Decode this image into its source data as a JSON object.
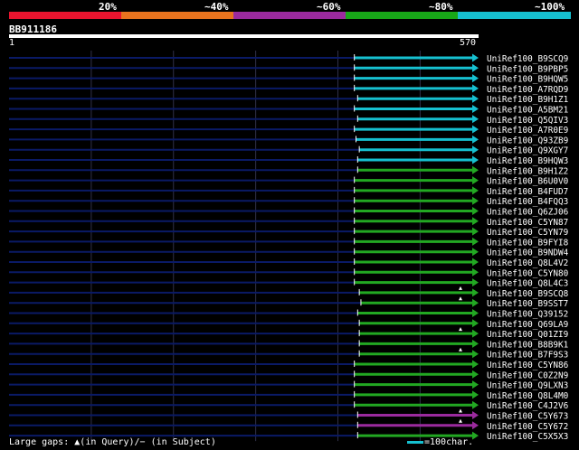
{
  "scale": {
    "labels": [
      "20%",
      "~40%",
      "~60%",
      "~80%",
      "~100%"
    ],
    "colors": [
      "#e8142e",
      "#e8731e",
      "#9b2a9e",
      "#18a818",
      "#16c0d0"
    ]
  },
  "query": {
    "id": "BB911186",
    "start": "1",
    "end": "570",
    "length": 570
  },
  "colors": {
    "cyan": "#16c0d0",
    "green": "#22a822",
    "purple": "#9b2a9e",
    "navy": "#0a1a66",
    "grid": "#30304a"
  },
  "hits": [
    {
      "name": "UniRef100_B9SCQ9",
      "start": 420,
      "color": "cyan",
      "gap": false
    },
    {
      "name": "UniRef100_B9PBP5",
      "start": 420,
      "color": "cyan",
      "gap": false
    },
    {
      "name": "UniRef100_B9HQW5",
      "start": 420,
      "color": "cyan",
      "gap": false
    },
    {
      "name": "UniRef100_A7RQD9",
      "start": 420,
      "color": "cyan",
      "gap": false
    },
    {
      "name": "UniRef100_B9H1Z1",
      "start": 424,
      "color": "cyan",
      "gap": false
    },
    {
      "name": "UniRef100_A5BM21",
      "start": 420,
      "color": "cyan",
      "gap": false
    },
    {
      "name": "UniRef100_Q5QIV3",
      "start": 424,
      "color": "cyan",
      "gap": false
    },
    {
      "name": "UniRef100_A7R0E9",
      "start": 420,
      "color": "cyan",
      "gap": false
    },
    {
      "name": "UniRef100_Q93ZB9",
      "start": 422,
      "color": "cyan",
      "gap": false
    },
    {
      "name": "UniRef100_Q9XGY7",
      "start": 426,
      "color": "cyan",
      "gap": false
    },
    {
      "name": "UniRef100_B9HQW3",
      "start": 424,
      "color": "cyan",
      "gap": false
    },
    {
      "name": "UniRef100_B9H1Z2",
      "start": 424,
      "color": "green",
      "gap": false
    },
    {
      "name": "UniRef100_B6U0V0",
      "start": 420,
      "color": "green",
      "gap": false
    },
    {
      "name": "UniRef100_B4FUD7",
      "start": 420,
      "color": "green",
      "gap": false
    },
    {
      "name": "UniRef100_B4FQQ3",
      "start": 420,
      "color": "green",
      "gap": false
    },
    {
      "name": "UniRef100_Q6ZJ06",
      "start": 420,
      "color": "green",
      "gap": false
    },
    {
      "name": "UniRef100_C5YN87",
      "start": 420,
      "color": "green",
      "gap": false
    },
    {
      "name": "UniRef100_C5YN79",
      "start": 420,
      "color": "green",
      "gap": false
    },
    {
      "name": "UniRef100_B9FYI8",
      "start": 420,
      "color": "green",
      "gap": false
    },
    {
      "name": "UniRef100_B9NDW4",
      "start": 420,
      "color": "green",
      "gap": false
    },
    {
      "name": "UniRef100_Q8L4V2",
      "start": 420,
      "color": "green",
      "gap": false
    },
    {
      "name": "UniRef100_C5YN80",
      "start": 420,
      "color": "green",
      "gap": false
    },
    {
      "name": "UniRef100_Q8L4C3",
      "start": 420,
      "color": "green",
      "gap": false
    },
    {
      "name": "UniRef100_B9SCQ8",
      "start": 426,
      "color": "green",
      "gap": true
    },
    {
      "name": "UniRef100_B9SST7",
      "start": 428,
      "color": "green",
      "gap": true
    },
    {
      "name": "UniRef100_Q39152",
      "start": 424,
      "color": "green",
      "gap": false
    },
    {
      "name": "UniRef100_Q69LA9",
      "start": 426,
      "color": "green",
      "gap": false
    },
    {
      "name": "UniRef100_Q01ZI9",
      "start": 426,
      "color": "green",
      "gap": true
    },
    {
      "name": "UniRef100_B8B9K1",
      "start": 426,
      "color": "green",
      "gap": false
    },
    {
      "name": "UniRef100_B7F9S3",
      "start": 426,
      "color": "green",
      "gap": true
    },
    {
      "name": "UniRef100_C5YN86",
      "start": 420,
      "color": "green",
      "gap": false
    },
    {
      "name": "UniRef100_C0Z2N9",
      "start": 420,
      "color": "green",
      "gap": false
    },
    {
      "name": "UniRef100_Q9LXN3",
      "start": 420,
      "color": "green",
      "gap": false
    },
    {
      "name": "UniRef100_Q8L4M0",
      "start": 420,
      "color": "green",
      "gap": false
    },
    {
      "name": "UniRef100_C4J2V6",
      "start": 420,
      "color": "green",
      "gap": false
    },
    {
      "name": "UniRef100_C5Y673",
      "start": 424,
      "color": "purple",
      "gap": true
    },
    {
      "name": "UniRef100_C5Y672",
      "start": 424,
      "color": "purple",
      "gap": true
    },
    {
      "name": "UniRef100_C5X5X3",
      "start": 424,
      "color": "green",
      "gap": false
    }
  ],
  "footer": {
    "legend_text": "Large gaps:",
    "query_gap": "(in Query)/",
    "subject_gap": "(in Subject)",
    "scale_text": "=100char."
  }
}
